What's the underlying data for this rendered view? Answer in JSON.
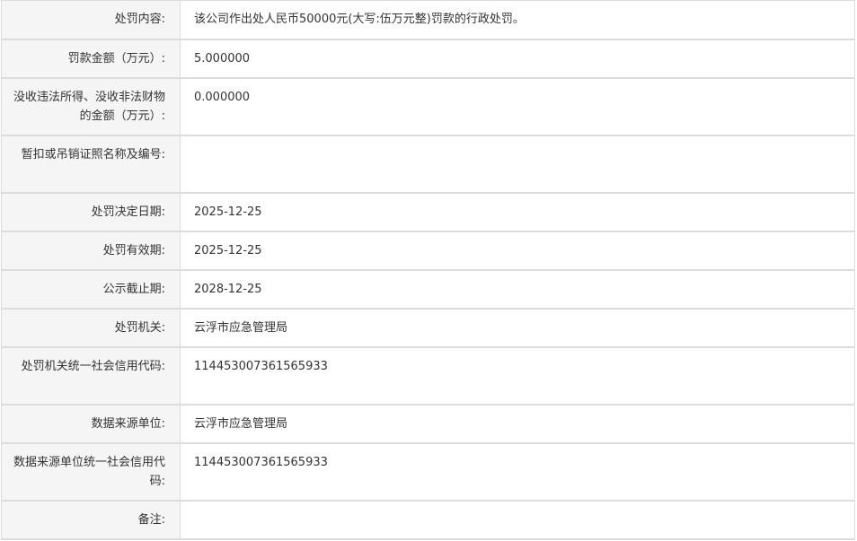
{
  "rows": [
    {
      "label": "处罚内容:",
      "value": "该公司作出处人民币50000元(大写:伍万元整)罚款的行政处罚。"
    },
    {
      "label": "罚款金额（万元）:",
      "value": "5.000000"
    },
    {
      "label": "没收违法所得、没收非法财物的金额（万元）:",
      "value": "0.000000"
    },
    {
      "label": "暂扣或吊销证照名称及编号:",
      "value": ""
    },
    {
      "label": "处罚决定日期:",
      "value": "2025-12-25"
    },
    {
      "label": "处罚有效期:",
      "value": "2025-12-25"
    },
    {
      "label": "公示截止期:",
      "value": "2028-12-25"
    },
    {
      "label": "处罚机关:",
      "value": "云浮市应急管理局"
    },
    {
      "label": "处罚机关统一社会信用代码:",
      "value": "114453007361565933"
    },
    {
      "label": "数据来源单位:",
      "value": "云浮市应急管理局"
    },
    {
      "label": "数据来源单位统一社会信用代码:",
      "value": "114453007361565933"
    },
    {
      "label": "备注:",
      "value": ""
    }
  ]
}
